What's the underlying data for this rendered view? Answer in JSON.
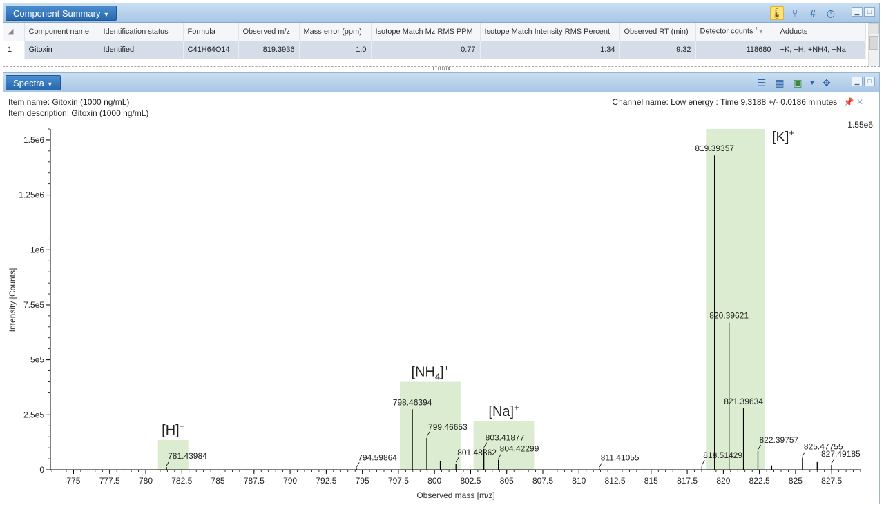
{
  "component_panel": {
    "title": "Component Summary",
    "toolbar_icons": [
      "thermometer-icon",
      "fork-icon",
      "hash-icon",
      "refresh-clock-icon"
    ],
    "columns": [
      "",
      "Component name",
      "Identification status",
      "Formula",
      "Observed m/z",
      "Mass error (ppm)",
      "Isotope Match Mz RMS PPM",
      "Isotope Match Intensity RMS Percent",
      "Observed RT (min)",
      "Detector counts",
      "Adducts"
    ],
    "sort_indicator": "1",
    "rows": [
      {
        "index": "1",
        "name": "Gitoxin",
        "status": "Identified",
        "formula": "C41H64O14",
        "mz": "819.3936",
        "mass_error": "1.0",
        "iso_mz": "0.77",
        "iso_int": "1.34",
        "rt": "9.32",
        "counts": "118680",
        "adducts": "+K, +H, +NH4, +Na"
      }
    ]
  },
  "spectra_panel": {
    "title": "Spectra",
    "toolbar_icons": [
      "list-icon",
      "table-icon",
      "image-export-icon",
      "pan-move-icon"
    ],
    "item_name": "Item name: Gitoxin (1000 ng/mL)",
    "item_description": "Item description: Gitoxin (1000 ng/mL)",
    "channel_name": "Channel name: Low energy : Time 9.3188 +/- 0.0186 minutes",
    "max_label": "1.55e6"
  },
  "chart_data": {
    "type": "bar",
    "xlabel": "Observed mass [m/z]",
    "ylabel": "Intensity [Counts]",
    "xlim": [
      773.4,
      829.5
    ],
    "ylim": [
      0,
      1550000
    ],
    "x_ticks": [
      "775",
      "777.5",
      "780",
      "782.5",
      "785",
      "787.5",
      "790",
      "792.5",
      "795",
      "797.5",
      "800",
      "802.5",
      "805",
      "807.5",
      "810",
      "812.5",
      "815",
      "817.5",
      "820",
      "822.5",
      "825",
      "827.5"
    ],
    "y_ticks": [
      {
        "value": 0,
        "label": "0"
      },
      {
        "value": 250000,
        "label": "2.5e5"
      },
      {
        "value": 500000,
        "label": "5e5"
      },
      {
        "value": 750000,
        "label": "7.5e5"
      },
      {
        "value": 1000000,
        "label": "1e6"
      },
      {
        "value": 1250000,
        "label": "1.25e6"
      },
      {
        "value": 1500000,
        "label": "1.5e6"
      }
    ],
    "regions": [
      {
        "label": "[H]",
        "sub": "",
        "x0": 780.85,
        "x1": 782.95,
        "height": 135000
      },
      {
        "label": "[NH",
        "sub": "4",
        "x0": 797.6,
        "x1": 801.8,
        "height": 400000
      },
      {
        "label": "[Na]",
        "sub": "",
        "x0": 802.7,
        "x1": 806.9,
        "height": 220000
      },
      {
        "label": "[K]",
        "sub": "",
        "x0": 818.8,
        "x1": 822.9,
        "height": 1550000
      }
    ],
    "peaks": [
      {
        "x": 781.43984,
        "y": 12000,
        "label": "781.43984"
      },
      {
        "x": 794.59864,
        "y": 5000,
        "label": "794.59864"
      },
      {
        "x": 798.46394,
        "y": 275000,
        "label": "798.46394"
      },
      {
        "x": 799.46653,
        "y": 145000,
        "label": "799.46653"
      },
      {
        "x": 800.4,
        "y": 40000,
        "label": ""
      },
      {
        "x": 801.48362,
        "y": 28000,
        "label": "801.48362"
      },
      {
        "x": 803.41877,
        "y": 95000,
        "label": "803.41877"
      },
      {
        "x": 804.42299,
        "y": 45000,
        "label": "804.42299"
      },
      {
        "x": 811.41055,
        "y": 5000,
        "label": "811.41055"
      },
      {
        "x": 818.51429,
        "y": 15000,
        "label": "818.51429"
      },
      {
        "x": 819.39357,
        "y": 1430000,
        "label": "819.39357"
      },
      {
        "x": 820.39621,
        "y": 670000,
        "label": "820.39621"
      },
      {
        "x": 821.39634,
        "y": 280000,
        "label": "821.39634"
      },
      {
        "x": 822.39757,
        "y": 85000,
        "label": "822.39757"
      },
      {
        "x": 823.35,
        "y": 20000,
        "label": ""
      },
      {
        "x": 825.47755,
        "y": 55000,
        "label": "825.47755"
      },
      {
        "x": 826.5,
        "y": 35000,
        "label": ""
      },
      {
        "x": 827.49185,
        "y": 22000,
        "label": "827.49185"
      }
    ],
    "region_color": "#dbecd0"
  }
}
